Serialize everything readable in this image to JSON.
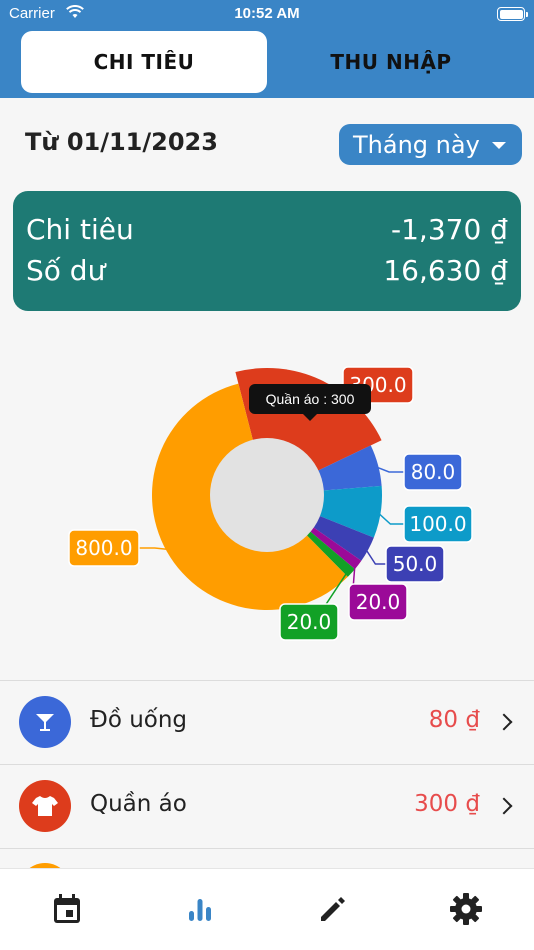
{
  "status_bar": {
    "carrier": "Carrier",
    "time": "10:52 AM"
  },
  "tabs": [
    {
      "label": "CHI TIÊU",
      "active": true
    },
    {
      "label": "THU NHẬP",
      "active": false
    }
  ],
  "date_range": {
    "label": "Từ 01/11/2023",
    "period": "Tháng này"
  },
  "summary": {
    "expense_label": "Chi tiêu",
    "expense_value": "-1,370 ₫",
    "balance_label": "Số dư",
    "balance_value": "16,630 ₫"
  },
  "chart_data": {
    "type": "pie",
    "style": "donut",
    "tooltip": "Quần áo : 300",
    "slices": [
      {
        "label": "300.0",
        "value": 300,
        "color": "#dd3c1c"
      },
      {
        "label": "80.0",
        "value": 80,
        "color": "#3b68d8"
      },
      {
        "label": "100.0",
        "value": 100,
        "color": "#0d9bc9"
      },
      {
        "label": "50.0",
        "value": 50,
        "color": "#3c40b4"
      },
      {
        "label": "20.0",
        "value": 20,
        "color": "#9b0a98"
      },
      {
        "label": "20.0",
        "value": 20,
        "color": "#12a126"
      },
      {
        "label": "800.0",
        "value": 800,
        "color": "#ff9d00"
      }
    ]
  },
  "categories": [
    {
      "name": "Đồ uống",
      "amount": "80 ₫",
      "icon": "cocktail-icon",
      "color": "#3b68d8"
    },
    {
      "name": "Quần áo",
      "amount": "300 ₫",
      "icon": "tshirt-icon",
      "color": "#dd3c1c"
    },
    {
      "name": "",
      "amount": "",
      "icon": "category-icon",
      "color": "#ff9d00"
    }
  ],
  "bottom_nav": [
    {
      "name": "calendar-icon",
      "active": false
    },
    {
      "name": "chart-icon",
      "active": true
    },
    {
      "name": "pencil-icon",
      "active": false
    },
    {
      "name": "gear-icon",
      "active": false
    }
  ],
  "colors": {
    "primary": "#3a85c6",
    "summary_bg": "#1e7a74",
    "amount_red": "#e74c4c"
  }
}
